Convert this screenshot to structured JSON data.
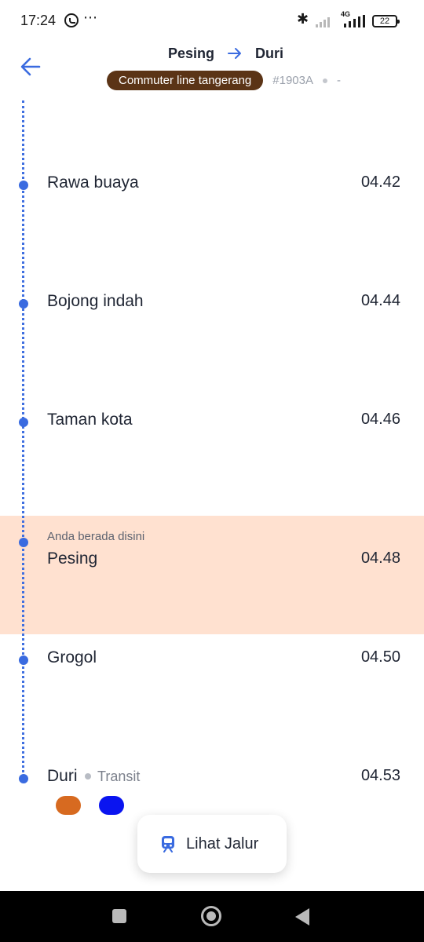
{
  "status_bar": {
    "time": "17:24",
    "more_icon": "⋯",
    "network_type": "4G",
    "battery": "22",
    "icons": [
      "whatsapp-icon",
      "more-icon",
      "bluetooth-icon",
      "signal-icon",
      "battery-icon"
    ]
  },
  "header": {
    "from": "Pesing",
    "to": "Duri",
    "line_name": "Commuter line tangerang",
    "train_number": "#1903A",
    "status": "-",
    "colors": {
      "line_badge": "#5b3416",
      "arrow": "#3a6be0"
    }
  },
  "stops": [
    {
      "name": "Rawa buaya",
      "time": "04.42"
    },
    {
      "name": "Bojong indah",
      "time": "04.44"
    },
    {
      "name": "Taman kota",
      "time": "04.46"
    },
    {
      "name": "Pesing",
      "time": "04.48",
      "current": true,
      "current_label": "Anda berada disini"
    },
    {
      "name": "Grogol",
      "time": "04.50"
    },
    {
      "name": "Duri",
      "time": "04.53",
      "transit_label": "Transit"
    }
  ],
  "transit_lines": [
    {
      "color": "#d76a20"
    },
    {
      "color": "#0a14f0"
    }
  ],
  "fab": {
    "label": "Lihat Jalur",
    "icon": "train-icon"
  },
  "theme": {
    "timeline": "#3a6be0",
    "highlight": "#ffe1d0"
  }
}
